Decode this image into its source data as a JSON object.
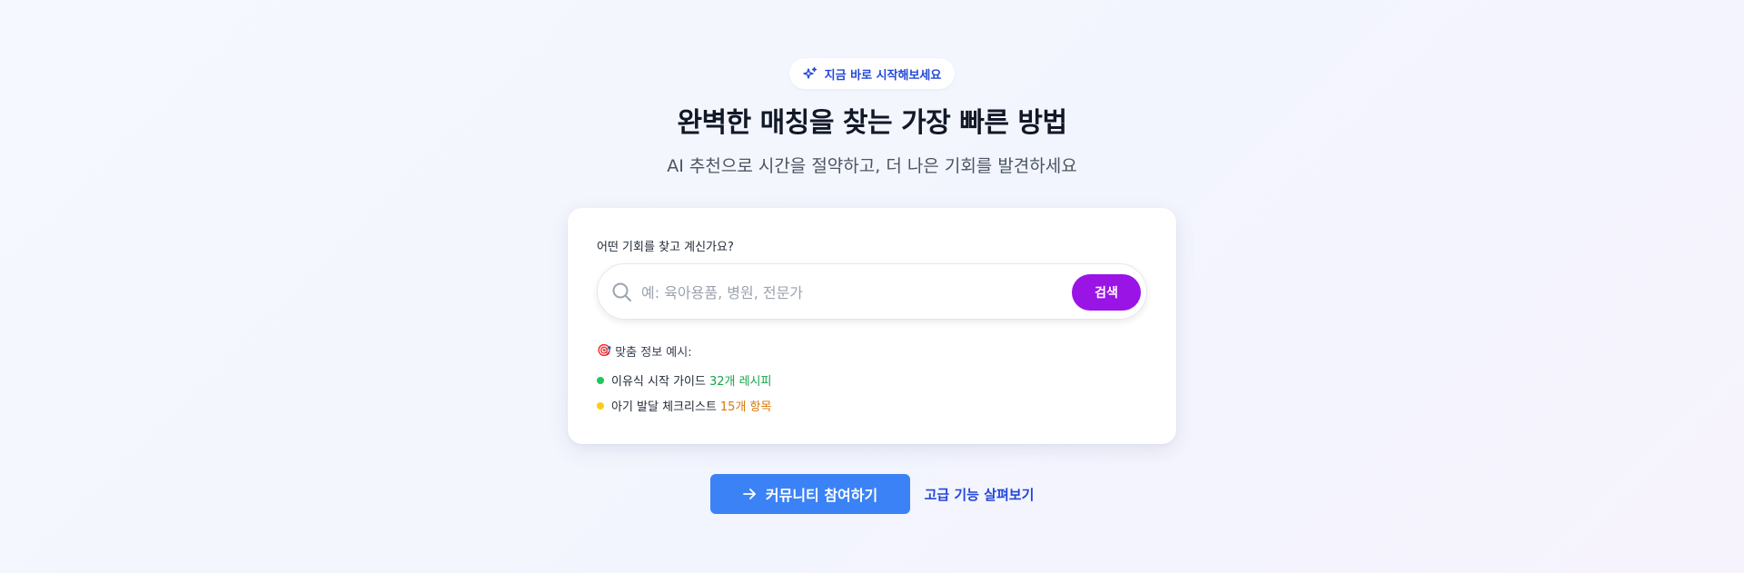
{
  "badge": {
    "icon": "sparkles-icon",
    "text": "지금 바로 시작해보세요"
  },
  "hero": {
    "title": "완벽한 매칭을 찾는 가장 빠른 방법",
    "subtitle": "AI 추천으로 시간을 절약하고, 더 나은 기회를 발견하세요"
  },
  "search_card": {
    "label": "어떤 기회를 찾고 계신가요?",
    "search": {
      "icon": "search-icon",
      "placeholder": "예: 육아용품, 병원, 전문가",
      "value": ""
    },
    "button_label": "검색",
    "examples_title": "맞춤 정보 예시:",
    "examples_emoji": "🎯",
    "examples": [
      {
        "text": "이유식 시작 가이드",
        "count": "32개 레시피",
        "color": "#22c55e"
      },
      {
        "text": "아기 발달 체크리스트",
        "count": "15개 항목",
        "color": "#facc15"
      }
    ]
  },
  "actions": {
    "primary": {
      "icon": "arrow-right-icon",
      "label": "커뮤니티 참여하기"
    },
    "secondary_label": "고급 기능 살펴보기"
  },
  "colors": {
    "accent_blue": "#3b82f6",
    "accent_purple": "#9a14e6",
    "badge_text": "#2348d8"
  }
}
